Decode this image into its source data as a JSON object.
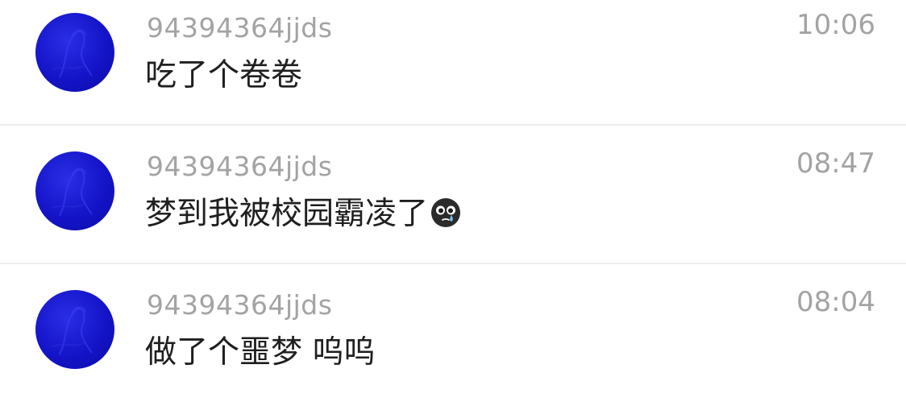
{
  "messages": [
    {
      "username": "94394364jjds",
      "text": "吃了个卷卷",
      "time": "10:06",
      "avatar_icon": "blue-avatar-icon"
    },
    {
      "username": "94394364jjds",
      "text": "梦到我被校园霸凌了",
      "time": "08:47",
      "avatar_icon": "blue-avatar-icon",
      "emoji_icon": "crying-face-emoji-icon"
    },
    {
      "username": "94394364jjds",
      "text": "做了个噩梦 呜呜",
      "time": "08:04",
      "avatar_icon": "blue-avatar-icon"
    }
  ],
  "colors": {
    "username": "#a3a3a3",
    "message": "#1f1f1f",
    "time": "#a3a3a3",
    "avatar": "#1414c8",
    "divider": "#ececec"
  }
}
